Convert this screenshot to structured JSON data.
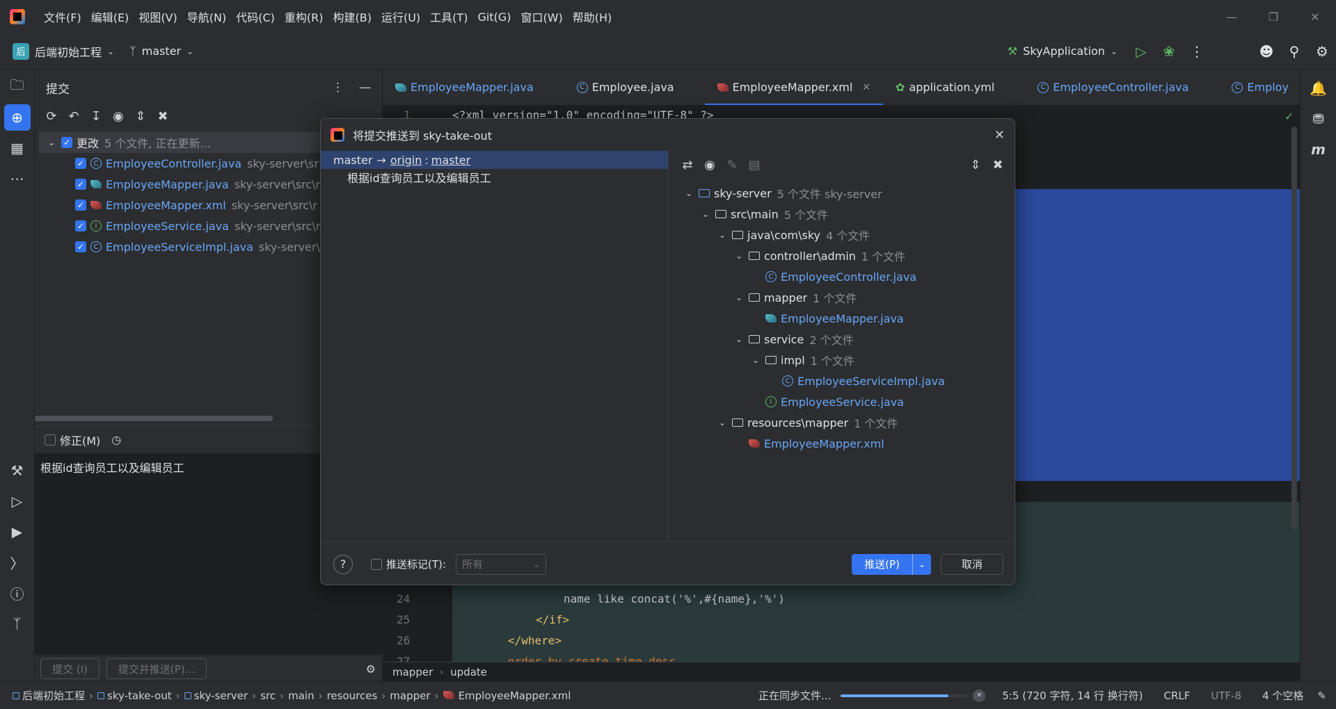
{
  "menu": [
    "文件(F)",
    "编辑(E)",
    "视图(V)",
    "导航(N)",
    "代码(C)",
    "重构(R)",
    "构建(B)",
    "运行(U)",
    "工具(T)",
    "Git(G)",
    "窗口(W)",
    "帮助(H)"
  ],
  "toolbar": {
    "project_badge": "后",
    "project": "后端初始工程",
    "branch": "master",
    "run_config": "SkyApplication"
  },
  "commit_panel": {
    "title": "提交",
    "changes_label": "更改",
    "changes_info": "5 个文件, 正在更新...",
    "files": [
      {
        "name": "EmployeeController.java",
        "path": "sky-server\\sr",
        "kind": "class"
      },
      {
        "name": "EmployeeMapper.java",
        "path": "sky-server\\src\\r",
        "kind": "mapper"
      },
      {
        "name": "EmployeeMapper.xml",
        "path": "sky-server\\src\\r",
        "kind": "xml"
      },
      {
        "name": "EmployeeService.java",
        "path": "sky-server\\src\\r",
        "kind": "interface"
      },
      {
        "name": "EmployeeServiceImpl.java",
        "path": "sky-server\\s",
        "kind": "class"
      }
    ],
    "amend_label": "修正(M)",
    "message": "根据id查询员工以及编辑员工",
    "commit_button": "提交 (I)",
    "commit_push_button": "提交并推送(P)..."
  },
  "tabs": [
    {
      "name": "EmployeeMapper.java",
      "kind": "mapper"
    },
    {
      "name": "Employee.java",
      "kind": "class"
    },
    {
      "name": "EmployeeMapper.xml",
      "kind": "xml",
      "active": true
    },
    {
      "name": "application.yml",
      "kind": "yml"
    },
    {
      "name": "EmployeeController.java",
      "kind": "class"
    },
    {
      "name": "Employ",
      "kind": "class"
    }
  ],
  "editor": {
    "line1": "<?xml version=\"1.0\" encoding=\"UTF-8\" ?>",
    "lines": [
      {
        "n": "24",
        "html": "name like concat('%',#{name},'%')"
      },
      {
        "n": "25",
        "html": "</if>"
      },
      {
        "n": "26",
        "html": "</where>"
      },
      {
        "n": "27",
        "html": "order by create_time desc"
      }
    ],
    "breadcrumb": [
      "mapper",
      "update"
    ]
  },
  "dialog": {
    "title": "将提交推送到 sky-take-out",
    "branch_local": "master",
    "arrow": "→",
    "remote": "origin",
    "sep": ":",
    "branch_remote": "master",
    "commit_message": "根据id查询员工以及编辑员工",
    "tree": [
      {
        "level": 0,
        "name": "sky-server",
        "info": "5 个文件  sky-server",
        "type": "module"
      },
      {
        "level": 1,
        "name": "src\\main",
        "info": "5 个文件",
        "type": "folder"
      },
      {
        "level": 2,
        "name": "java\\com\\sky",
        "info": "4 个文件",
        "type": "folder"
      },
      {
        "level": 3,
        "name": "controller\\admin",
        "info": "1 个文件",
        "type": "folder"
      },
      {
        "level": 4,
        "name": "EmployeeController.java",
        "info": "",
        "type": "class"
      },
      {
        "level": 3,
        "name": "mapper",
        "info": "1 个文件",
        "type": "folder"
      },
      {
        "level": 4,
        "name": "EmployeeMapper.java",
        "info": "",
        "type": "mapper"
      },
      {
        "level": 3,
        "name": "service",
        "info": "2 个文件",
        "type": "folder"
      },
      {
        "level": 4,
        "name": "impl",
        "info": "1 个文件",
        "type": "folder"
      },
      {
        "level": 5,
        "name": "EmployeeServiceImpl.java",
        "info": "",
        "type": "class"
      },
      {
        "level": 4,
        "name": "EmployeeService.java",
        "info": "",
        "type": "interface"
      },
      {
        "level": 2,
        "name": "resources\\mapper",
        "info": "1 个文件",
        "type": "folder"
      },
      {
        "level": 3,
        "name": "EmployeeMapper.xml",
        "info": "",
        "type": "xml"
      }
    ],
    "push_tags_label": "推送标记(T):",
    "tags_select": "所有",
    "push_button": "推送(P)",
    "cancel_button": "取消"
  },
  "statusbar": {
    "path": [
      "后端初始工程",
      "sky-take-out",
      "sky-server",
      "src",
      "main",
      "resources",
      "mapper",
      "EmployeeMapper.xml"
    ],
    "sync": "正在同步文件...",
    "progress": 0.85,
    "position": "5:5 (720 字符, 14 行 换行符)",
    "line_ending": "CRLF",
    "encoding": "UTF-8",
    "indent": "4 个空格"
  },
  "colors": {
    "accent": "#3574f0",
    "bg": "#1e1f22",
    "panel": "#2b2d30",
    "link": "#6aa7f8"
  }
}
